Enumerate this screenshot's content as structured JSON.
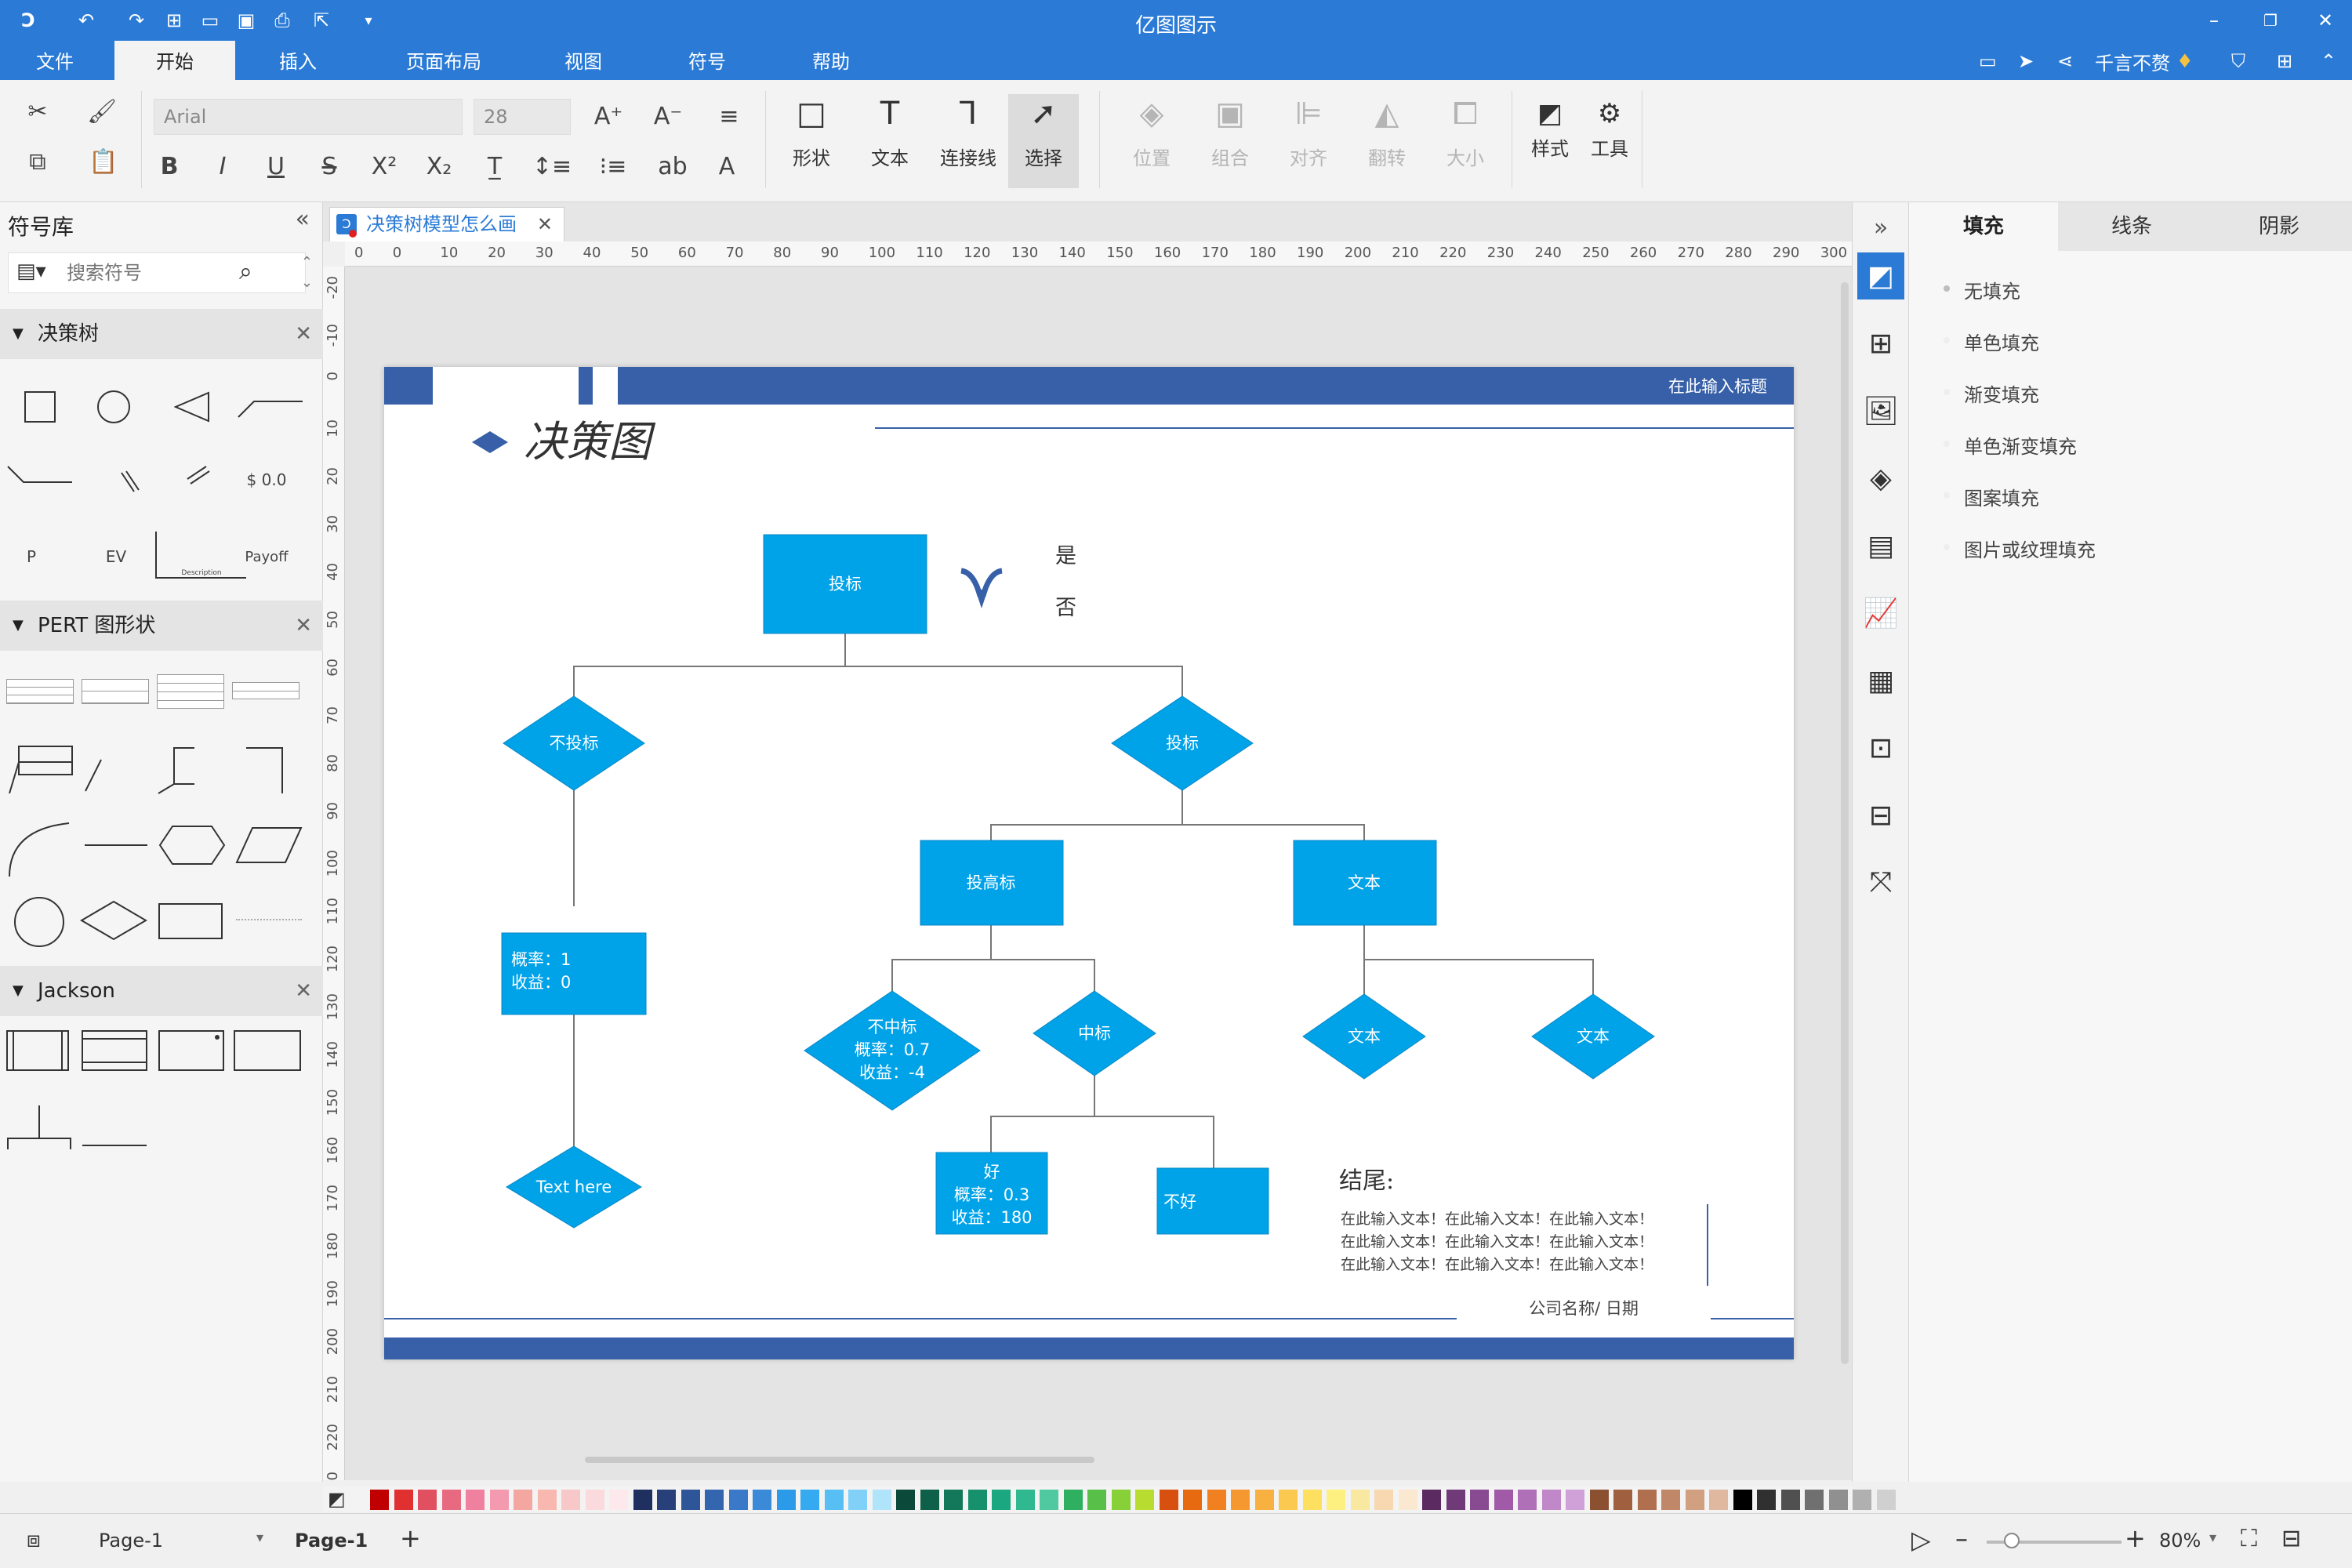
{
  "app": {
    "title": "亿图图示"
  },
  "menus": [
    "文件",
    "开始",
    "插入",
    "页面布局",
    "视图",
    "符号",
    "帮助"
  ],
  "user": {
    "name": "千言不赘"
  },
  "ribbon": {
    "font": "Arial",
    "size": "28",
    "tools": [
      {
        "label": "形状"
      },
      {
        "label": "文本"
      },
      {
        "label": "连接线"
      },
      {
        "label": "选择"
      }
    ],
    "arrange": [
      {
        "label": "位置"
      },
      {
        "label": "组合"
      },
      {
        "label": "对齐"
      },
      {
        "label": "翻转"
      },
      {
        "label": "大小"
      }
    ],
    "style_label": "样式",
    "tools_label": "工具"
  },
  "library": {
    "title": "符号库",
    "search_placeholder": "搜索符号",
    "sections": [
      {
        "name": "决策树"
      },
      {
        "name": "PERT 图形状"
      },
      {
        "name": "Jackson"
      }
    ],
    "dt_labels": {
      "dollar": "$ 0.0",
      "p": "P",
      "ev": "EV",
      "desc": "Description",
      "payoff": "Payoff"
    }
  },
  "tab": {
    "name": "决策树模型怎么画"
  },
  "ruler": {
    "h": [
      "0",
      "0",
      "10",
      "20",
      "30",
      "40",
      "50",
      "60",
      "70",
      "80",
      "90",
      "100",
      "110",
      "120",
      "130",
      "140",
      "150",
      "160",
      "170",
      "180",
      "190",
      "200",
      "210",
      "220",
      "230",
      "240",
      "250",
      "260",
      "270",
      "280",
      "290",
      "300"
    ],
    "v": [
      "-20",
      "-10",
      "0",
      "10",
      "20",
      "30",
      "40",
      "50",
      "60",
      "70",
      "80",
      "90",
      "100",
      "110",
      "120",
      "130",
      "140",
      "150",
      "160",
      "170",
      "180",
      "190",
      "200",
      "210",
      "220",
      "230"
    ]
  },
  "diagram": {
    "header_text": "在此输入标题",
    "title": "决策图",
    "legend": {
      "yes": "是",
      "no": "否"
    },
    "nodes": {
      "root": "投标",
      "no_bid": "不投标",
      "bid": "投标",
      "prob1_line1": "概率：1",
      "prob1_line2": "收益：0",
      "text_here": "Text here",
      "high_bid": "投高标",
      "text_r": "文本",
      "lose_line1": "不中标",
      "lose_line2": "概率：0.7",
      "lose_line3": "收益：-4",
      "win": "中标",
      "text_d1": "文本",
      "text_d2": "文本",
      "good_line1": "好",
      "good_line2": "概率：0.3",
      "good_line3": "收益：180",
      "bad": "不好"
    },
    "ending_title": "结尾:",
    "ending_lines": [
      "在此输入文本！在此输入文本！在此输入文本！",
      "在此输入文本！在此输入文本！在此输入文本！",
      "在此输入文本！在此输入文本！在此输入文本！"
    ],
    "footer": "公司名称/ 日期"
  },
  "right_panel": {
    "tabs": [
      "填充",
      "线条",
      "阴影"
    ],
    "options": [
      "无填充",
      "单色填充",
      "渐变填充",
      "单色渐变填充",
      "图案填充",
      "图片或纹理填充"
    ]
  },
  "status": {
    "page_selector": "Page-1",
    "page_tab": "Page-1",
    "zoom": "80%"
  },
  "colors": {
    "accent": "#2b7bd6",
    "node_fill": "#00a2e8",
    "band": "#3760a8",
    "palette": [
      "#c00000",
      "#e03030",
      "#e05060",
      "#e86a80",
      "#f080a0",
      "#f49ab0",
      "#f4a6a0",
      "#f8b8b0",
      "#f8c8c8",
      "#fadadd",
      "#fde9ec",
      "#1f2f5f",
      "#28407a",
      "#2e5597",
      "#3466b0",
      "#3a78c8",
      "#3a8ad8",
      "#2b9ae8",
      "#35aaf0",
      "#58bff5",
      "#80d0f8",
      "#b0e4fb",
      "#0b4a3a",
      "#0f6048",
      "#13785a",
      "#17906c",
      "#1ba880",
      "#30b890",
      "#50c8a0",
      "#2eb060",
      "#58c048",
      "#88d038",
      "#b8dc30",
      "#d85010",
      "#e86a10",
      "#f08020",
      "#f59830",
      "#f8b040",
      "#fbc850",
      "#fde060",
      "#fdf080",
      "#f8e8a0",
      "#f8d8b0",
      "#fae8d0",
      "#5a2a60",
      "#703a78",
      "#884a90",
      "#a05aa8",
      "#b070b8",
      "#c088c8",
      "#d0a0d8",
      "#8a5030",
      "#a06040",
      "#b07050",
      "#c08868",
      "#d0a080",
      "#e0b8a0",
      "#000000",
      "#303030",
      "#505050",
      "#707070",
      "#909090",
      "#b0b0b0",
      "#d0d0d0",
      "#f0f0f0"
    ]
  }
}
